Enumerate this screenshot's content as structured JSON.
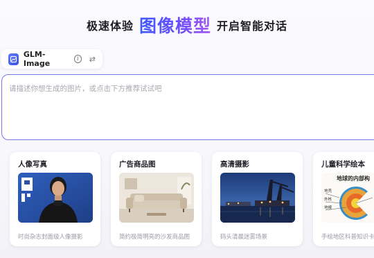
{
  "headline": {
    "prefix": "极速体验",
    "accent": "图像模型",
    "suffix": "开启智能对话"
  },
  "model_selector": {
    "name": "GLM-Image",
    "info_icon": "info-icon",
    "switch_icon": "switch-arrows-icon"
  },
  "prompt": {
    "placeholder": "请描述你想生成的图片，或点击下方推荐试试吧",
    "value": ""
  },
  "cards": [
    {
      "title": "人像写真",
      "desc": "时尚杂志封面级人像摄影",
      "image": "portrait-photo"
    },
    {
      "title": "广告商品图",
      "desc": "简约极简明亮的沙发商品图",
      "image": "sofa-product-photo"
    },
    {
      "title": "高清摄影",
      "desc": "码头清晨迷雾场景",
      "image": "harbor-night-photo"
    },
    {
      "title": "儿童科学绘本",
      "desc": "手绘地区科普知识卡",
      "image": "earth-interior-illustration",
      "image_heading": "地球的内部构",
      "image_labels": [
        "地壳",
        "外核",
        "地幔"
      ]
    }
  ],
  "colors": {
    "accent_start": "#3e5bff",
    "accent_end": "#a45bf0",
    "input_border": "#7a78ea"
  }
}
